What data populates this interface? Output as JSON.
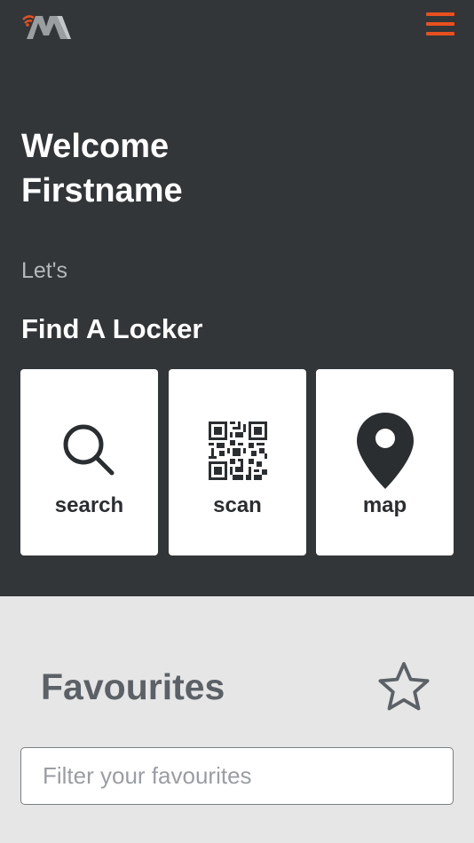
{
  "header": {
    "logo_icon": "brand-logo-m-with-signal",
    "menu_icon": "hamburger-menu-icon",
    "accent_color": "#e8501f"
  },
  "hero": {
    "welcome_line1": "Welcome",
    "welcome_line2": "Firstname",
    "lets": "Let's",
    "find_title": "Find A Locker"
  },
  "actions": [
    {
      "label": "search",
      "icon": "magnifier-icon"
    },
    {
      "label": "scan",
      "icon": "qr-code-icon"
    },
    {
      "label": "map",
      "icon": "map-pin-icon"
    }
  ],
  "favourites": {
    "title": "Favourites",
    "star_icon": "star-outline-icon",
    "filter_placeholder": "Filter your favourites",
    "filter_value": ""
  }
}
